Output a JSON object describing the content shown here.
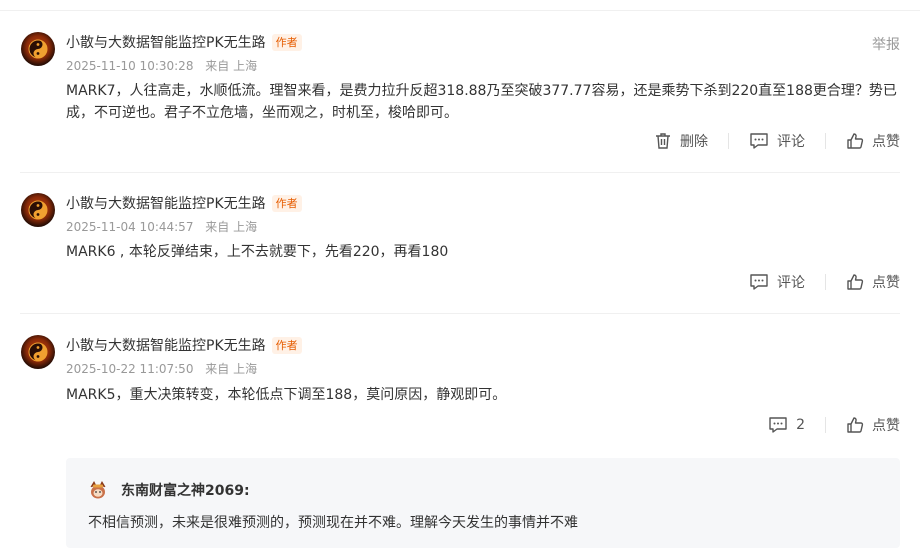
{
  "comments": [
    {
      "author": "小散与大数据智能监控PK无生路",
      "badge": "作者",
      "date": "2025-11-10 10:30:28",
      "location": "来自 上海",
      "report": "举报",
      "content": "MARK7，人往高走，水顺低流。理智来看，是费力拉升反超318.88乃至突破377.77容易，还是乘势下杀到220直至188更合理？势已成，不可逆也。君子不立危墙，坐而观之，时机至，梭哈即可。",
      "delete_label": "删除",
      "comment_label": "评论",
      "like_label": "点赞"
    },
    {
      "author": "小散与大数据智能监控PK无生路",
      "badge": "作者",
      "date": "2025-11-04 10:44:57",
      "location": "来自 上海",
      "content": "MARK6 , 本轮反弹结束，上不去就要下，先看220，再看180",
      "comment_label": "评论",
      "like_label": "点赞"
    },
    {
      "author": "小散与大数据智能监控PK无生路",
      "badge": "作者",
      "date": "2025-10-22 11:07:50",
      "location": "来自 上海",
      "content": "MARK5，重大决策转变，本轮低点下调至188，莫问原因，静观即可。",
      "comment_count": "2",
      "like_label": "点赞",
      "reply": {
        "author": "东南财富之神2069:",
        "text": "不相信预测，未来是很难预测的，预测现在并不难。理解今天发生的事情并不难"
      }
    }
  ],
  "icons": {
    "avatar": "yin-yang-icon",
    "delete": "trash-icon",
    "comment": "chat-bubble-icon",
    "like": "thumbs-up-icon",
    "reply_avatar": "cartoon-avatar-icon"
  },
  "colors": {
    "badge_text": "#e65c00",
    "badge_bg": "#fff1e6",
    "meta": "#999999",
    "reply_bg": "#f6f7f9"
  }
}
